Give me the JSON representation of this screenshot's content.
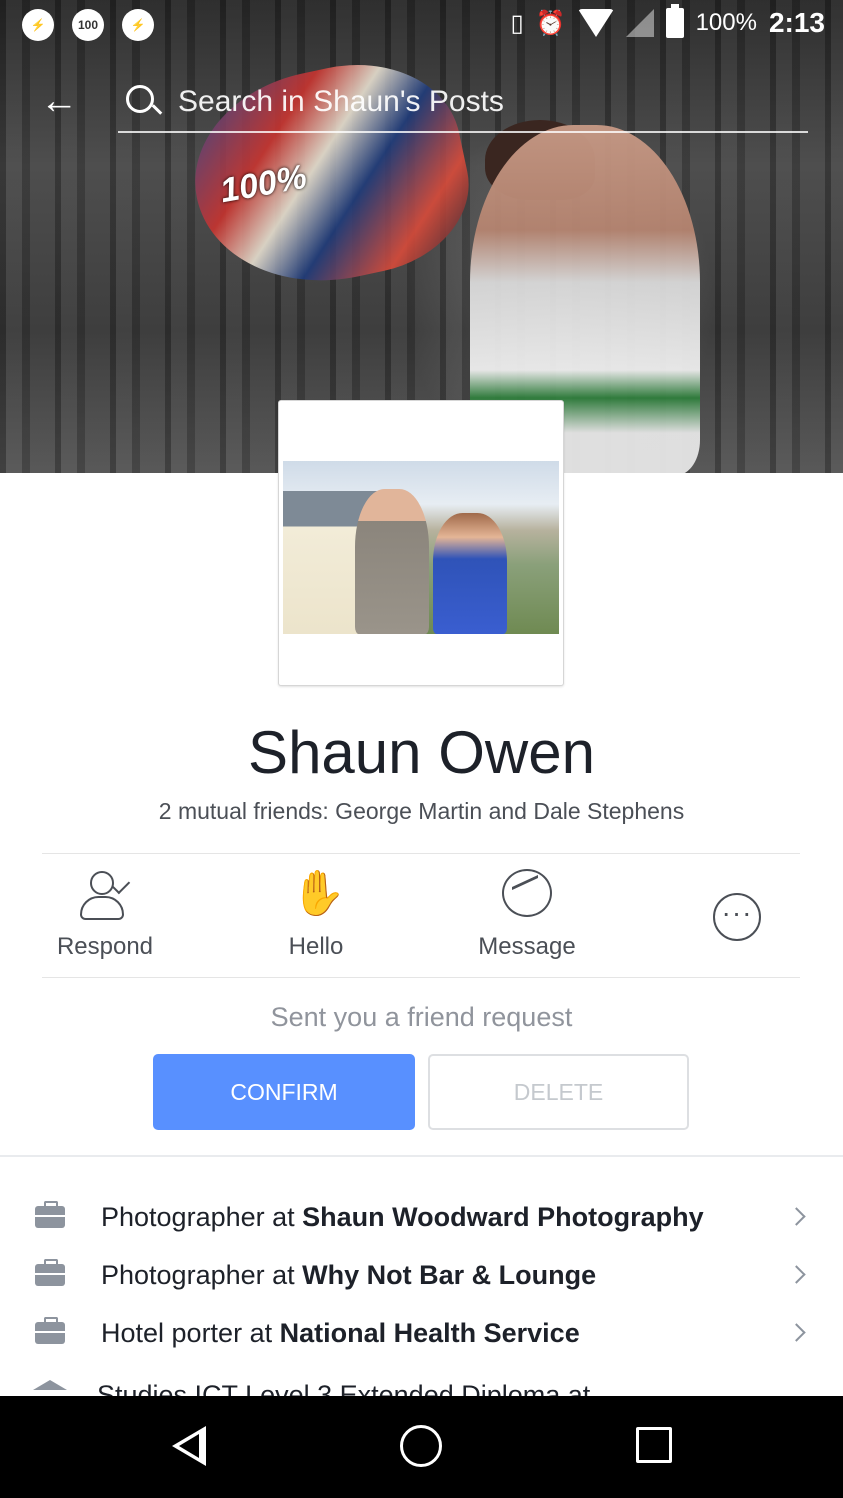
{
  "status_bar": {
    "notif_badge": "100",
    "battery_percent": "100%",
    "time": "2:13"
  },
  "search": {
    "placeholder": "Search in Shaun's Posts"
  },
  "cover_photo": {
    "helmet_text": "100%"
  },
  "profile": {
    "name": "Shaun Owen",
    "mutual_friends": "2 mutual friends: George Martin and Dale Stephens"
  },
  "actions": [
    {
      "label": "Respond",
      "icon": "person-check-icon"
    },
    {
      "label": "Hello",
      "icon": "wave-hand-icon"
    },
    {
      "label": "Message",
      "icon": "messenger-icon"
    },
    {
      "label": "",
      "icon": "more-icon"
    }
  ],
  "friend_request": {
    "text": "Sent you a friend request",
    "confirm_label": "CONFIRM",
    "delete_label": "DELETE"
  },
  "about": [
    {
      "prefix": "Photographer at ",
      "place": "Shaun Woodward Photography",
      "icon": "briefcase-icon"
    },
    {
      "prefix": "Photographer at ",
      "place": "Why Not Bar & Lounge",
      "icon": "briefcase-icon"
    },
    {
      "prefix": "Hotel porter at ",
      "place": "National Health Service",
      "icon": "briefcase-icon"
    },
    {
      "prefix": "Studies ICT Level 3 Extended Diploma at",
      "place": "",
      "icon": "graduation-cap-icon"
    }
  ],
  "colors": {
    "confirm_blue": "#5890ff",
    "text_dark": "#1d2129",
    "text_gray": "#4b4f56",
    "text_light": "#90949c"
  }
}
